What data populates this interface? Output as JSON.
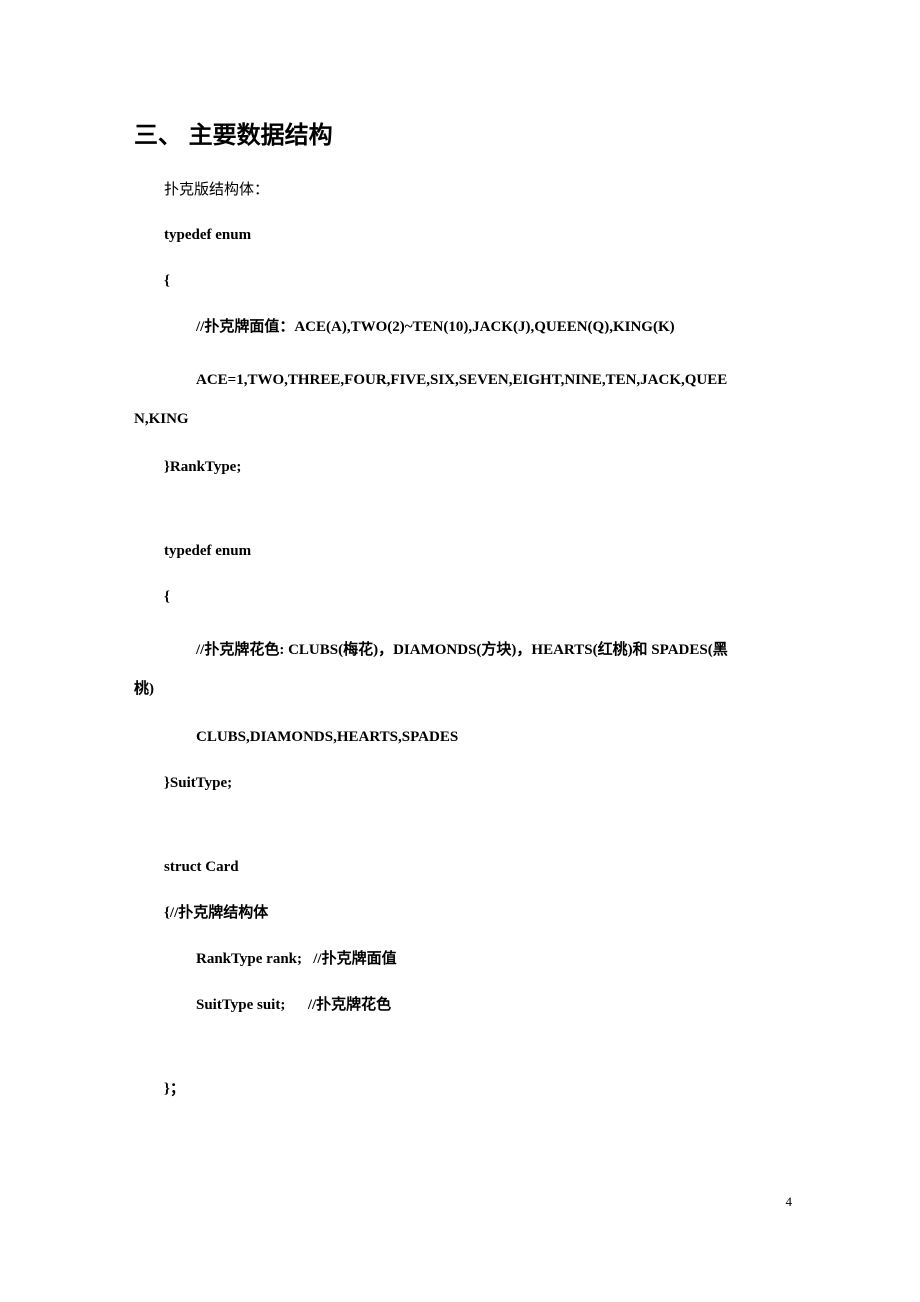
{
  "heading": "三、 主要数据结构",
  "subtitle": "扑克版结构体：",
  "l1": "typedef enum",
  "l2": "{",
  "l3": "//扑克牌面值：ACE(A),TWO(2)~TEN(10),JACK(J),QUEEN(Q),KING(K)",
  "l4a": "ACE=1,TWO,THREE,FOUR,FIVE,SIX,SEVEN,EIGHT,NINE,TEN,JACK,QUEE",
  "l4b": "N,KING",
  "l5": "}RankType;",
  "l6": "typedef enum",
  "l7": "{",
  "l8a": "//扑克牌花色: CLUBS(梅花)，DIAMONDS(方块)，HEARTS(红桃)和 SPADES(黑",
  "l8b": "桃)",
  "l9": "CLUBS,DIAMONDS,HEARTS,SPADES",
  "l10": "}SuitType;",
  "l11": "struct Card",
  "l12": "{//扑克牌结构体",
  "l13a": "RankType rank;",
  "l13b": "//扑克牌面值",
  "l14a": "SuitType suit;",
  "l14b": "//扑克牌花色",
  "l15": "}；",
  "page_num": "4"
}
